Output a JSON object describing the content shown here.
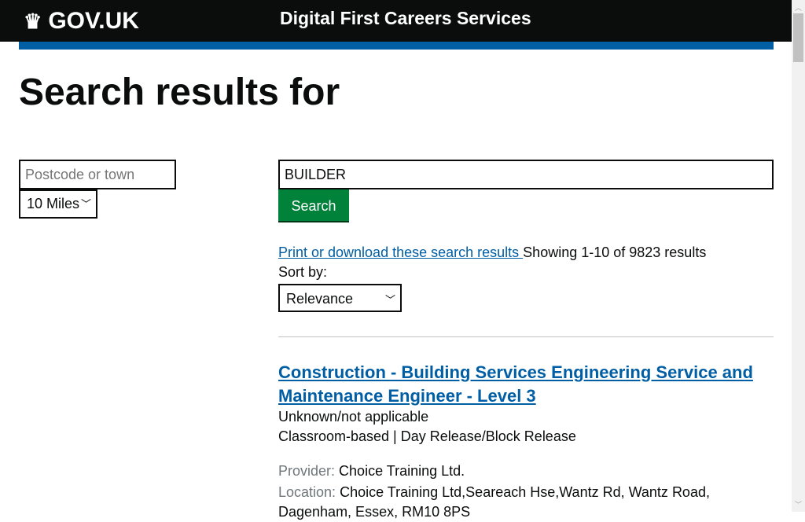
{
  "header": {
    "logo": "GOV.UK",
    "service": "Digital First Careers Services"
  },
  "page_title": "Search results for",
  "filters": {
    "location_placeholder": "Postcode or town",
    "distance": "10 Miles"
  },
  "search": {
    "keyword": "BUILDER",
    "button": "Search"
  },
  "results_info": {
    "print_link": "Print or download these search results ",
    "showing": "Showing 1-10 of 9823 results",
    "sort_label": "Sort by:",
    "sort_value": "Relevance"
  },
  "results": [
    {
      "title": "Construction - Building Services Engineering Service and Maintenance Engineer - Level 3",
      "start": "Unknown/not applicable",
      "mode": "Classroom-based | Day Release/Block Release",
      "provider_label": "Provider:",
      "provider": "Choice Training Ltd.",
      "location_label": "Location:",
      "location": "Choice Training Ltd,Seareach Hse,Wantz Rd, Wantz Road, Dagenham, Essex, RM10 8PS"
    }
  ]
}
